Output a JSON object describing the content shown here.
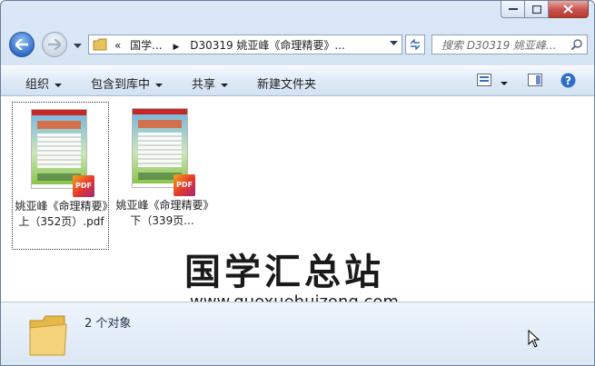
{
  "address": {
    "path_parts": [
      "国学...",
      "D30319 姚亚峰《命理精要》..."
    ]
  },
  "search": {
    "placeholder": "搜索 D30319 姚亚峰..."
  },
  "toolbar": {
    "organize": "组织",
    "include_in_library": "包含到库中",
    "share": "共享",
    "new_folder": "新建文件夹"
  },
  "files": [
    {
      "name": "姚亚峰《命理精要》上（352页）.pdf",
      "badge": "PDF"
    },
    {
      "name": "姚亚峰《命理精要》下（339页...",
      "badge": "PDF"
    }
  ],
  "watermark": {
    "title": "国学汇总站",
    "url": "www.guoxuehuizong.com"
  },
  "status": {
    "count": "2 个对象"
  }
}
